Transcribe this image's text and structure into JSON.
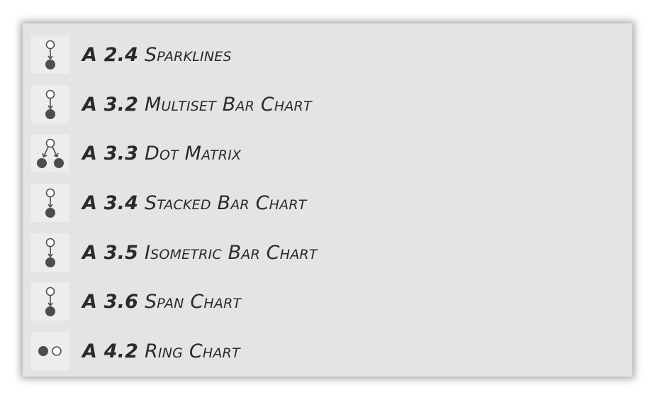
{
  "items": [
    {
      "num": "A 2.4",
      "title": "Sparklines",
      "icon": "single-dependency-icon"
    },
    {
      "num": "A 3.2",
      "title": "Multiset Bar Chart",
      "icon": "single-dependency-icon"
    },
    {
      "num": "A 3.3",
      "title": "Dot Matrix",
      "icon": "split-dependency-icon"
    },
    {
      "num": "A 3.4",
      "title": "Stacked Bar Chart",
      "icon": "single-dependency-icon"
    },
    {
      "num": "A 3.5",
      "title": "Isometric Bar Chart",
      "icon": "single-dependency-icon"
    },
    {
      "num": "A 3.6",
      "title": "Span Chart",
      "icon": "single-dependency-icon"
    },
    {
      "num": "A 4.2",
      "title": "Ring Chart",
      "icon": "filled-open-pair-icon"
    }
  ],
  "colors": {
    "dot_fill": "#4d4d4d",
    "dot_open": "#ffffff",
    "panel_bg": "#e4e4e6"
  }
}
